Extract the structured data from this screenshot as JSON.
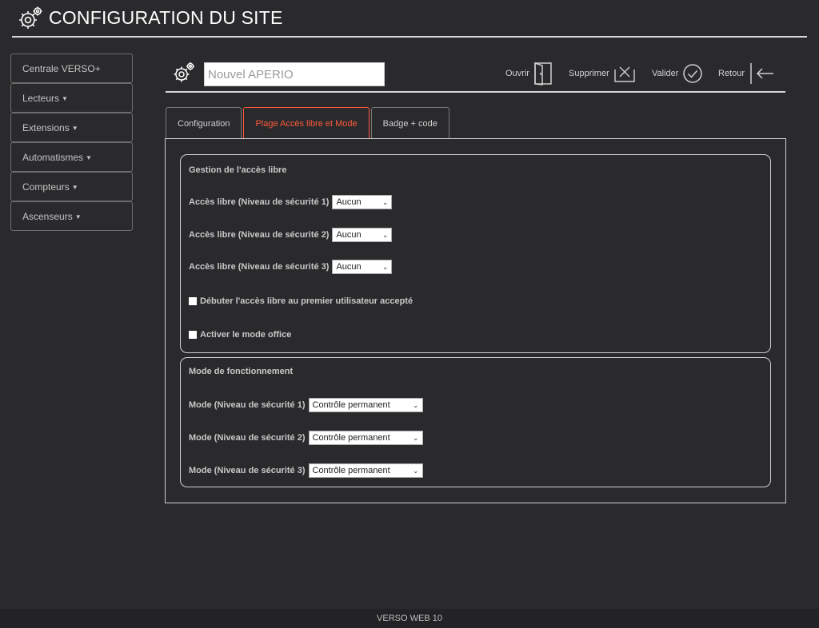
{
  "header": {
    "title": "CONFIGURATION DU SITE"
  },
  "sidebar": {
    "items": [
      {
        "label": "Centrale VERSO+",
        "caret": ""
      },
      {
        "label": "Lecteurs",
        "caret": "▼"
      },
      {
        "label": "Extensions",
        "caret": "▼"
      },
      {
        "label": "Automatismes",
        "caret": "▼"
      },
      {
        "label": "Compteurs",
        "caret": "▼"
      },
      {
        "label": "Ascenseurs",
        "caret": "▼"
      }
    ]
  },
  "toolbar": {
    "name_value": "Nouvel APERIO",
    "open_label": "Ouvrir",
    "delete_label": "Supprimer",
    "validate_label": "Valider",
    "back_label": "Retour"
  },
  "tabs": [
    {
      "label": "Configuration",
      "active": false
    },
    {
      "label": "Plage Accès libre et Mode",
      "active": true
    },
    {
      "label": "Badge + code",
      "active": false
    }
  ],
  "free_access": {
    "title": "Gestion de l'accès libre",
    "rows": [
      {
        "label": "Accès libre (Niveau de sécurité 1)",
        "value": "Aucun"
      },
      {
        "label": "Accès libre (Niveau de sécurité 2)",
        "value": "Aucun"
      },
      {
        "label": "Accès libre (Niveau de sécurité 3)",
        "value": "Aucun"
      }
    ],
    "checkboxes": [
      {
        "label": "Débuter l'accès libre au premier utilisateur accepté",
        "checked": false
      },
      {
        "label": "Activer le mode office",
        "checked": false
      }
    ]
  },
  "mode": {
    "title": "Mode de fonctionnement",
    "rows": [
      {
        "label": "Mode (Niveau de sécurité 1)",
        "value": "Contrôle permanent"
      },
      {
        "label": "Mode (Niveau de sécurité 2)",
        "value": "Contrôle permanent"
      },
      {
        "label": "Mode (Niveau de sécurité 3)",
        "value": "Contrôle permanent"
      }
    ]
  },
  "footer": {
    "text": "VERSO WEB 10"
  },
  "colors": {
    "background": "#2a2a2d",
    "accent": "#ff5a3c",
    "text": "#cfcfcf"
  }
}
